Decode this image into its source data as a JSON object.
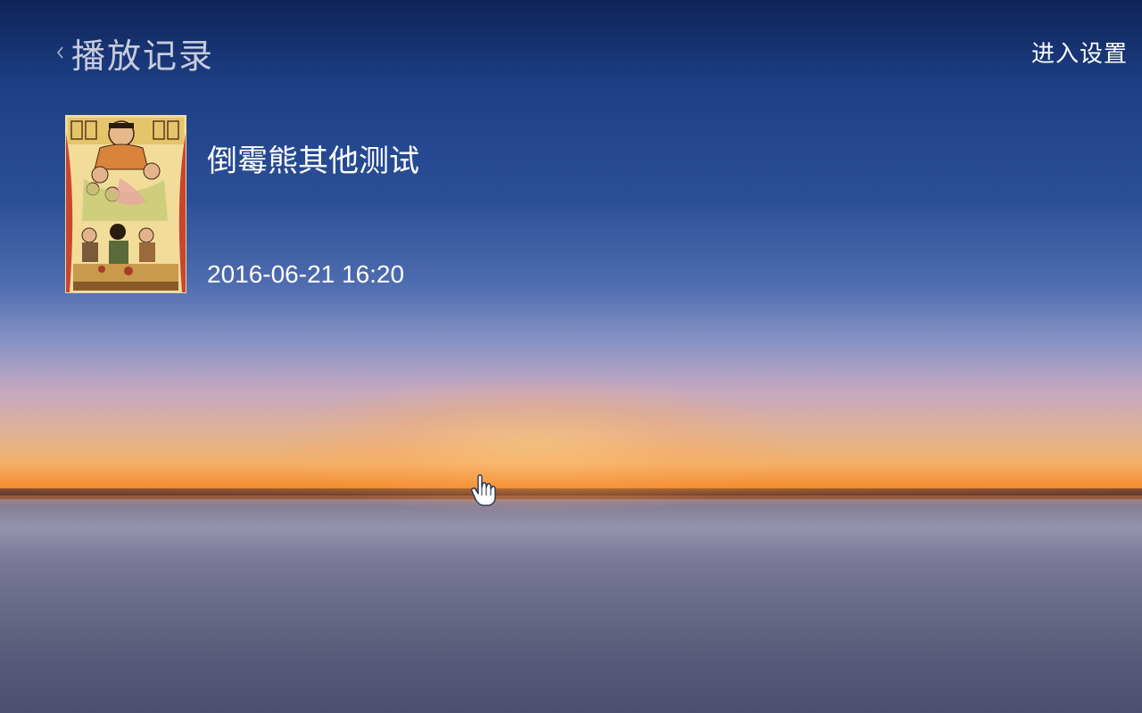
{
  "header": {
    "title": "播放记录",
    "settings_label": "进入设置"
  },
  "history": [
    {
      "title": "倒霉熊其他测试",
      "timestamp": "2016-06-21 16:20",
      "poster_icon": "movie-poster-thumbnail"
    }
  ],
  "colors": {
    "text_primary": "#ffffff",
    "title_muted": "#e6e6f0",
    "sky_top": "#0f2357",
    "sunset_orange": "#f38a2c",
    "water": "#6f6f8e"
  },
  "icons": {
    "back": "chevron-left-icon",
    "cursor": "hand-pointer-icon"
  }
}
